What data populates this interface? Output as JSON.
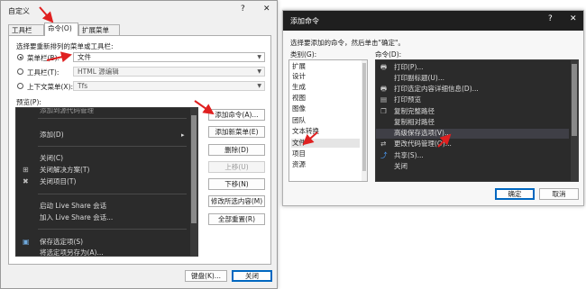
{
  "customize_dialog": {
    "title": "自定义",
    "help_glyph": "?",
    "close_glyph": "✕",
    "tabs": [
      {
        "label": "工具栏(T)"
      },
      {
        "label": "命令(O)"
      },
      {
        "label": "扩展菜单(E)"
      }
    ],
    "instruction": "选择要重新排列的菜单或工具栏:",
    "menubar": {
      "label": "菜单栏(B):",
      "value": "文件"
    },
    "toolbar": {
      "label": "工具栏(T):",
      "value": "HTML 源编辑"
    },
    "context_menu": {
      "label": "上下文菜单(X):",
      "value": "Tfs"
    },
    "preview_label": "预览(P):",
    "preview_items": [
      {
        "text": "添加到源代码管理",
        "icon": ""
      },
      {
        "text": "添加(D)",
        "icon": "",
        "submenu": "▸"
      },
      {
        "text": "关闭(C)",
        "icon": ""
      },
      {
        "text": "关闭解决方案(T)",
        "icon": "⊞"
      },
      {
        "text": "关闭项目(T)",
        "icon": "✖"
      },
      {
        "text": "启动 Live Share 会话",
        "icon": ""
      },
      {
        "text": "加入 Live Share 会话...",
        "icon": ""
      },
      {
        "text": "保存选定项(S)",
        "icon": "▣"
      },
      {
        "text": "将选定项另存为(A)...",
        "icon": ""
      }
    ],
    "buttons": {
      "add_command": "添加命令(A)...",
      "add_menu": "添加新菜单(E)",
      "delete": "删除(D)",
      "move_up": "上移(U)",
      "move_down": "下移(N)",
      "modify_selection": "修改所选内容(M)",
      "reset_all": "全部重置(R)",
      "keyboard": "键盘(K)...",
      "close": "关闭"
    }
  },
  "add_command_dialog": {
    "title": "添加命令",
    "help_glyph": "?",
    "close_glyph": "✕",
    "instruction": "选择要添加的命令，然后单击\"确定\"。",
    "categories_label": "类别(G):",
    "commands_label": "命令(D):",
    "categories": [
      "扩展",
      "设计",
      "生成",
      "视图",
      "图像",
      "团队",
      "文本转换",
      "文件",
      "项目",
      "资源"
    ],
    "selected_category": "文件",
    "commands": [
      {
        "text": "打印(P)...",
        "icon": "🖶"
      },
      {
        "text": "打印副标题(U)...",
        "icon": ""
      },
      {
        "text": "打印选定内容详细信息(D)...",
        "icon": "🖶"
      },
      {
        "text": "打印预览",
        "icon": "▤"
      },
      {
        "text": "复制完整路径",
        "icon": "❐"
      },
      {
        "text": "复制相对路径",
        "icon": ""
      },
      {
        "text": "高级保存选项(V)...",
        "icon": ""
      },
      {
        "text": "更改代码管理(O)...",
        "icon": "⇄"
      },
      {
        "text": "共享(S)...",
        "icon": "⤴"
      },
      {
        "text": "关闭",
        "icon": ""
      }
    ],
    "selected_command": "高级保存选项(V)...",
    "ok": "确定",
    "cancel": "取消"
  },
  "colors": {
    "dark_bg": "#2b2b2b",
    "annotation_red": "#e02020",
    "accent_blue": "#0067c0"
  }
}
